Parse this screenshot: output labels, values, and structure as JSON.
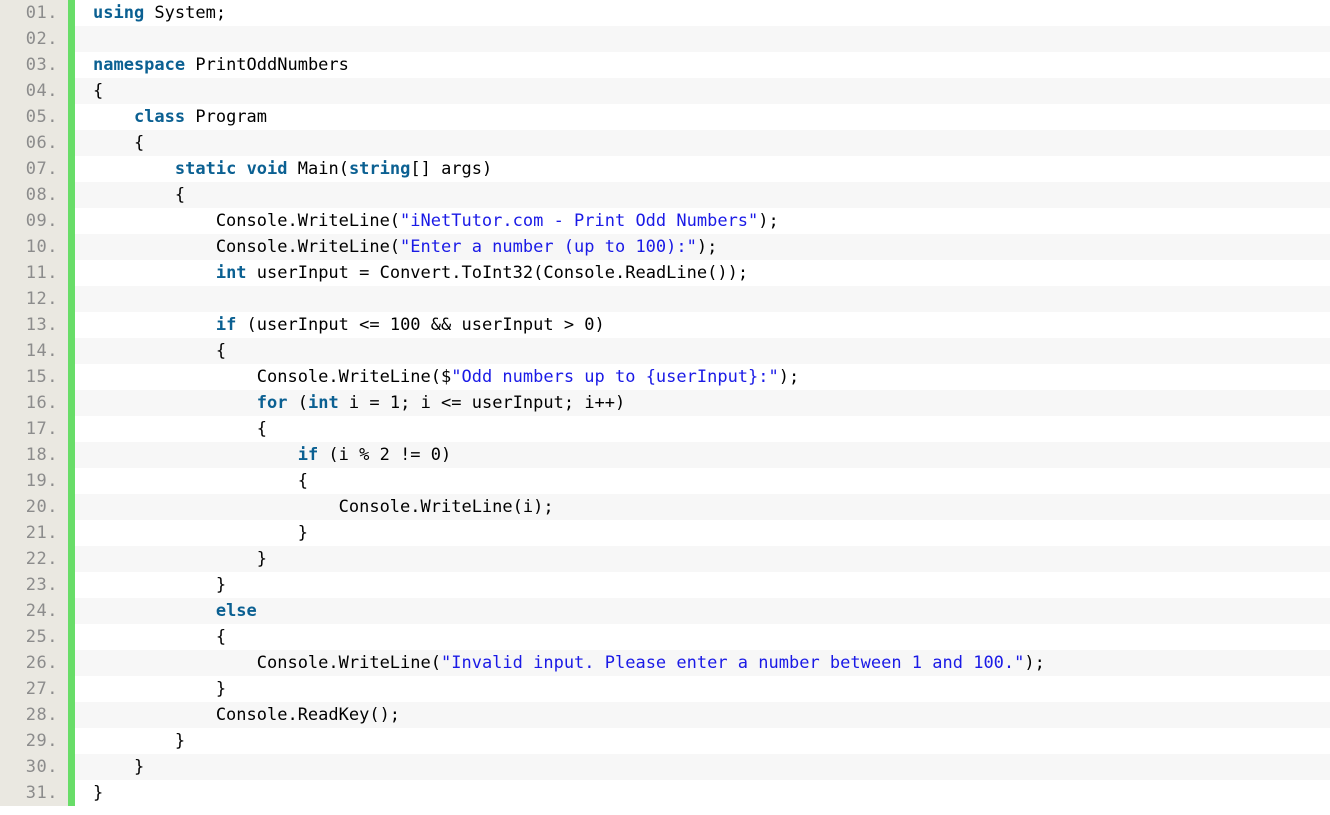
{
  "editor": {
    "language": "csharp",
    "title": "PrintOddNumbers",
    "total_lines": 31,
    "line_number_suffix": ".",
    "colors": {
      "gutter_background": "#eae8e1",
      "line_number_text": "#8c8c8c",
      "accent_bar": "#68dd68",
      "row_background": "#ffffff",
      "row_background_alt": "#f7f7f7",
      "keyword": "#0b6092",
      "string": "#1a1ae6",
      "plain_text": "#000000"
    }
  },
  "lines": [
    {
      "n": "01.",
      "tokens": [
        {
          "t": "kw",
          "v": "using"
        },
        {
          "t": "pln",
          "v": " System;"
        }
      ]
    },
    {
      "n": "02.",
      "tokens": [
        {
          "t": "pln",
          "v": ""
        }
      ]
    },
    {
      "n": "03.",
      "tokens": [
        {
          "t": "kw",
          "v": "namespace"
        },
        {
          "t": "pln",
          "v": " PrintOddNumbers"
        }
      ]
    },
    {
      "n": "04.",
      "tokens": [
        {
          "t": "pln",
          "v": "{"
        }
      ]
    },
    {
      "n": "05.",
      "tokens": [
        {
          "t": "pln",
          "v": "    "
        },
        {
          "t": "kw",
          "v": "class"
        },
        {
          "t": "pln",
          "v": " Program"
        }
      ]
    },
    {
      "n": "06.",
      "tokens": [
        {
          "t": "pln",
          "v": "    {"
        }
      ]
    },
    {
      "n": "07.",
      "tokens": [
        {
          "t": "pln",
          "v": "        "
        },
        {
          "t": "kw",
          "v": "static"
        },
        {
          "t": "pln",
          "v": " "
        },
        {
          "t": "kw",
          "v": "void"
        },
        {
          "t": "pln",
          "v": " Main("
        },
        {
          "t": "kw",
          "v": "string"
        },
        {
          "t": "pln",
          "v": "[] args)"
        }
      ]
    },
    {
      "n": "08.",
      "tokens": [
        {
          "t": "pln",
          "v": "        {"
        }
      ]
    },
    {
      "n": "09.",
      "tokens": [
        {
          "t": "pln",
          "v": "            Console.WriteLine("
        },
        {
          "t": "str",
          "v": "\"iNetTutor.com - Print Odd Numbers\""
        },
        {
          "t": "pln",
          "v": ");"
        }
      ]
    },
    {
      "n": "10.",
      "tokens": [
        {
          "t": "pln",
          "v": "            Console.WriteLine("
        },
        {
          "t": "str",
          "v": "\"Enter a number (up to 100):\""
        },
        {
          "t": "pln",
          "v": ");"
        }
      ]
    },
    {
      "n": "11.",
      "tokens": [
        {
          "t": "pln",
          "v": "            "
        },
        {
          "t": "kw",
          "v": "int"
        },
        {
          "t": "pln",
          "v": " userInput = Convert.ToInt32(Console.ReadLine());"
        }
      ]
    },
    {
      "n": "12.",
      "tokens": [
        {
          "t": "pln",
          "v": ""
        }
      ]
    },
    {
      "n": "13.",
      "tokens": [
        {
          "t": "pln",
          "v": "            "
        },
        {
          "t": "kw",
          "v": "if"
        },
        {
          "t": "pln",
          "v": " (userInput <= 100 && userInput > 0)"
        }
      ]
    },
    {
      "n": "14.",
      "tokens": [
        {
          "t": "pln",
          "v": "            {"
        }
      ]
    },
    {
      "n": "15.",
      "tokens": [
        {
          "t": "pln",
          "v": "                Console.WriteLine($"
        },
        {
          "t": "str",
          "v": "\"Odd numbers up to {userInput}:\""
        },
        {
          "t": "pln",
          "v": ");"
        }
      ]
    },
    {
      "n": "16.",
      "tokens": [
        {
          "t": "pln",
          "v": "                "
        },
        {
          "t": "kw",
          "v": "for"
        },
        {
          "t": "pln",
          "v": " ("
        },
        {
          "t": "kw",
          "v": "int"
        },
        {
          "t": "pln",
          "v": " i = 1; i <= userInput; i++)"
        }
      ]
    },
    {
      "n": "17.",
      "tokens": [
        {
          "t": "pln",
          "v": "                {"
        }
      ]
    },
    {
      "n": "18.",
      "tokens": [
        {
          "t": "pln",
          "v": "                    "
        },
        {
          "t": "kw",
          "v": "if"
        },
        {
          "t": "pln",
          "v": " (i % 2 != 0)"
        }
      ]
    },
    {
      "n": "19.",
      "tokens": [
        {
          "t": "pln",
          "v": "                    {"
        }
      ]
    },
    {
      "n": "20.",
      "tokens": [
        {
          "t": "pln",
          "v": "                        Console.WriteLine(i);"
        }
      ]
    },
    {
      "n": "21.",
      "tokens": [
        {
          "t": "pln",
          "v": "                    }"
        }
      ]
    },
    {
      "n": "22.",
      "tokens": [
        {
          "t": "pln",
          "v": "                }"
        }
      ]
    },
    {
      "n": "23.",
      "tokens": [
        {
          "t": "pln",
          "v": "            }"
        }
      ]
    },
    {
      "n": "24.",
      "tokens": [
        {
          "t": "pln",
          "v": "            "
        },
        {
          "t": "kw",
          "v": "else"
        }
      ]
    },
    {
      "n": "25.",
      "tokens": [
        {
          "t": "pln",
          "v": "            {"
        }
      ]
    },
    {
      "n": "26.",
      "tokens": [
        {
          "t": "pln",
          "v": "                Console.WriteLine("
        },
        {
          "t": "str",
          "v": "\"Invalid input. Please enter a number between 1 and 100.\""
        },
        {
          "t": "pln",
          "v": ");"
        }
      ]
    },
    {
      "n": "27.",
      "tokens": [
        {
          "t": "pln",
          "v": "            }"
        }
      ]
    },
    {
      "n": "28.",
      "tokens": [
        {
          "t": "pln",
          "v": "            Console.ReadKey();"
        }
      ]
    },
    {
      "n": "29.",
      "tokens": [
        {
          "t": "pln",
          "v": "        }"
        }
      ]
    },
    {
      "n": "30.",
      "tokens": [
        {
          "t": "pln",
          "v": "    }"
        }
      ]
    },
    {
      "n": "31.",
      "tokens": [
        {
          "t": "pln",
          "v": "}"
        }
      ]
    }
  ]
}
